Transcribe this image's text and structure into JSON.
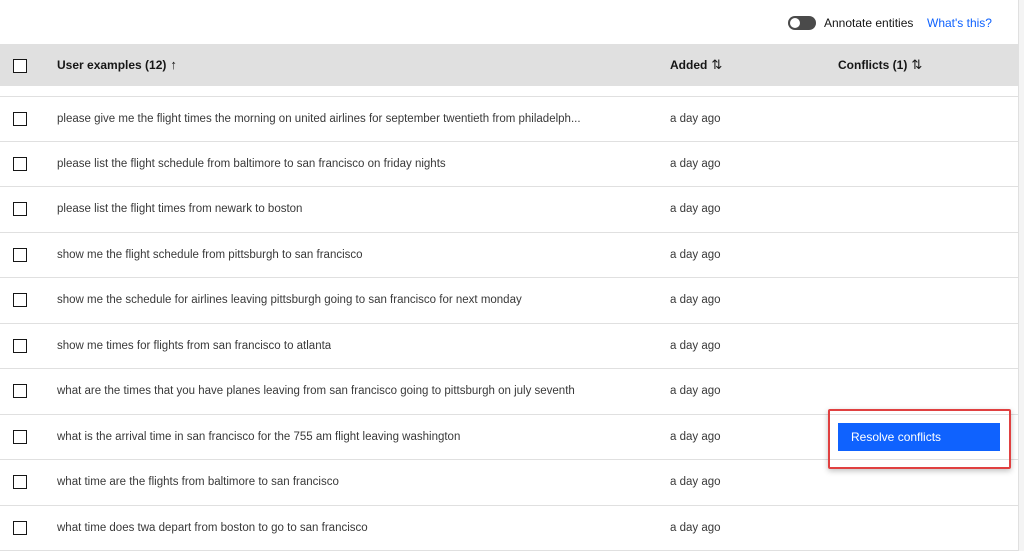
{
  "toolbar": {
    "annotate_label": "Annotate entities",
    "whats_this": "What's this?",
    "annotate_on": false
  },
  "table": {
    "headers": {
      "examples": "User examples (12)",
      "examples_sort": "↑",
      "added": "Added",
      "added_sort": "⇅",
      "conflicts": "Conflicts (1)",
      "conflicts_sort": "⇅"
    },
    "rows": [
      {
        "text": "please give me the flight times the morning on united airlines for september twentieth from philadelph...",
        "added": "a day ago"
      },
      {
        "text": "please list the flight schedule from baltimore to san francisco on friday nights",
        "added": "a day ago"
      },
      {
        "text": "please list the flight times from newark to boston",
        "added": "a day ago"
      },
      {
        "text": "show me the flight schedule from pittsburgh to san francisco",
        "added": "a day ago"
      },
      {
        "text": "show me the schedule for airlines leaving pittsburgh going to san francisco for next monday",
        "added": "a day ago"
      },
      {
        "text": "show me times for flights from san francisco to atlanta",
        "added": "a day ago"
      },
      {
        "text": "what are the times that you have planes leaving from san francisco going to pittsburgh on july seventh",
        "added": "a day ago"
      },
      {
        "text": "what is the arrival time in san francisco for the 755 am flight leaving washington",
        "added": "a day ago",
        "conflict_action": "Resolve conflicts"
      },
      {
        "text": "what time are the flights from baltimore to san francisco",
        "added": "a day ago"
      },
      {
        "text": "what time does twa depart from boston to go to san francisco",
        "added": "a day ago"
      }
    ]
  },
  "colors": {
    "primary": "#0f62fe",
    "highlight": "#e04040",
    "header_bg": "#e0e0e0"
  }
}
